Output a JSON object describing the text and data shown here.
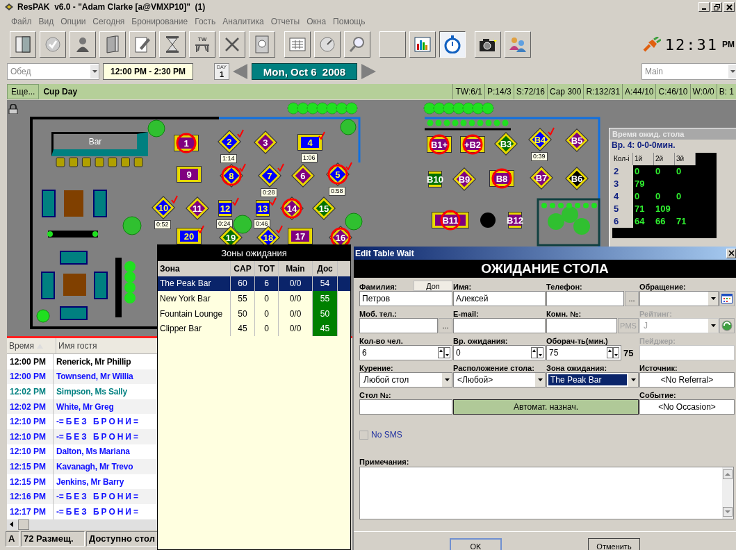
{
  "window": {
    "title": "ResPAK  v6.0 - \"Adam Clarke [a@VMXP10]\"  (1)"
  },
  "menu": [
    "Файл",
    "Вид",
    "Опции",
    "Сегодня",
    "Бронирование",
    "Гость",
    "Аналитика",
    "Отчеты",
    "Окна",
    "Помощь"
  ],
  "toolbar": {
    "tw_badge": "TW",
    "buttons": [
      {
        "selected": false
      },
      {
        "selected": false
      },
      {
        "selected": false
      },
      {
        "selected": false
      },
      {
        "selected": false
      },
      {
        "selected": false
      },
      {
        "selected": false
      },
      {
        "selected": false
      },
      {
        "selected": false
      },
      {
        "selected": false
      },
      {
        "selected": false
      },
      {
        "selected": false
      },
      {
        "selected": false
      },
      {
        "selected": false
      },
      {
        "selected": true
      },
      {
        "selected": false
      },
      {
        "selected": false
      }
    ]
  },
  "clock": {
    "time": "12:31",
    "ampm": "PM"
  },
  "date_bar": {
    "meal": "Обед",
    "time_range": "12:00 PM - 2:30 PM",
    "day_badge": "DAY",
    "day_number": "1",
    "date": "Mon, Oct 6  2008",
    "area": "Main"
  },
  "status_strip": {
    "more_button": "Еще...",
    "event": "Cup Day",
    "stats": [
      "TW:6/1",
      "P:14/3",
      "S:72/16",
      "Cap 300",
      "R:132/31",
      "A:44/10",
      "C:46/10",
      "W:0/0",
      "B: 1"
    ]
  },
  "floor": {
    "bar_label": "Bar",
    "tables": [
      {
        "label": "1",
        "kind": "rect",
        "color": "#800080",
        "checked": false,
        "reserved": true
      },
      {
        "label": "2",
        "kind": "diamond",
        "color": "#0000ff",
        "checked": true,
        "reserved": false,
        "timer": "1:14"
      },
      {
        "label": "3",
        "kind": "diamond",
        "color": "#800080",
        "checked": false,
        "reserved": false
      },
      {
        "label": "4",
        "kind": "rect",
        "color": "#0000ff",
        "checked": true,
        "reserved": false,
        "timer": "1:06"
      },
      {
        "label": "B1+",
        "kind": "rect",
        "color": "#800080",
        "checked": false,
        "reserved": true
      },
      {
        "label": "+B2",
        "kind": "rect",
        "color": "#800080",
        "checked": false,
        "reserved": true
      },
      {
        "label": "B3",
        "kind": "diamond",
        "color": "#007000",
        "checked": false,
        "reserved": false
      },
      {
        "label": "B4",
        "kind": "diamond",
        "color": "#0000ff",
        "checked": true,
        "reserved": false,
        "timer": "0:39"
      },
      {
        "label": "B5",
        "kind": "diamond",
        "color": "#800080",
        "checked": false,
        "reserved": false
      },
      {
        "label": "9",
        "kind": "rect",
        "color": "#800080",
        "checked": false,
        "reserved": false
      },
      {
        "label": "8",
        "kind": "diamond",
        "color": "#0000ff",
        "checked": true,
        "reserved": true
      },
      {
        "label": "7",
        "kind": "diamond",
        "color": "#0000ff",
        "checked": true,
        "reserved": false,
        "timer": "0:28"
      },
      {
        "label": "6",
        "kind": "diamond",
        "color": "#800080",
        "checked": false,
        "reserved": false
      },
      {
        "label": "5",
        "kind": "diamond",
        "color": "#0000ff",
        "checked": true,
        "reserved": true,
        "timer": "0:58"
      },
      {
        "label": "B10",
        "kind": "square",
        "color": "#007000",
        "checked": false,
        "reserved": false
      },
      {
        "label": "B9",
        "kind": "diamond",
        "color": "#800080",
        "checked": false,
        "reserved": false
      },
      {
        "label": "B8",
        "kind": "rect",
        "color": "#800080",
        "checked": false,
        "reserved": true
      },
      {
        "label": "B7",
        "kind": "diamond",
        "color": "#800080",
        "checked": false,
        "reserved": false
      },
      {
        "label": "B6",
        "kind": "diamond",
        "color": "#000000",
        "checked": false,
        "reserved": false
      },
      {
        "label": "10",
        "kind": "diamond",
        "color": "#0000ff",
        "checked": true,
        "reserved": false,
        "timer": "0:52"
      },
      {
        "label": "11",
        "kind": "diamond",
        "color": "#800080",
        "checked": false,
        "reserved": false
      },
      {
        "label": "12",
        "kind": "square",
        "color": "#0000ff",
        "checked": true,
        "reserved": false,
        "timer": "0:24"
      },
      {
        "label": "13",
        "kind": "square",
        "color": "#0000ff",
        "checked": true,
        "reserved": false,
        "timer": "0:46"
      },
      {
        "label": "14",
        "kind": "diamond",
        "color": "#800080",
        "checked": false,
        "reserved": true
      },
      {
        "label": "15",
        "kind": "diamond",
        "color": "#007000",
        "checked": false,
        "reserved": false
      },
      {
        "label": "B11",
        "kind": "wide",
        "color": "#800080",
        "checked": false,
        "reserved": true
      },
      {
        "label": "B12",
        "kind": "square",
        "color": "#800080",
        "checked": false,
        "reserved": false
      },
      {
        "label": "20",
        "kind": "rect",
        "color": "#0000ff",
        "checked": true,
        "reserved": false
      },
      {
        "label": "19",
        "kind": "diamond",
        "color": "#007000",
        "checked": false,
        "reserved": false
      },
      {
        "label": "18",
        "kind": "diamond",
        "color": "#0000ff",
        "checked": true,
        "reserved": false
      },
      {
        "label": "17",
        "kind": "rect",
        "color": "#800080",
        "checked": false,
        "reserved": false
      },
      {
        "label": "16",
        "kind": "diamond",
        "color": "#800080",
        "checked": false,
        "reserved": true
      }
    ]
  },
  "wait_panel": {
    "title": "Время ожид. стола",
    "summary": "Вр. 4: 0-0-0мин.",
    "columns": [
      "Кол-і",
      "1й",
      "2й",
      "3й"
    ],
    "rows": [
      {
        "size": "2",
        "values": [
          "0",
          "0",
          "0"
        ]
      },
      {
        "size": "3",
        "values": [
          "79"
        ]
      },
      {
        "size": "4",
        "values": [
          "0",
          "0",
          "0"
        ]
      },
      {
        "size": "5",
        "values": [
          "71",
          "109"
        ]
      },
      {
        "size": "6",
        "values": [
          "64",
          "66",
          "71"
        ]
      }
    ]
  },
  "guest_list": {
    "columns": [
      "Время",
      "Имя гостя"
    ],
    "rows": [
      {
        "time": "12:00 PM",
        "name": "Renerick, Mr Phillip",
        "color": "#000000"
      },
      {
        "time": "12:00 PM",
        "name": "Townsend, Mr Willia",
        "color": "#1010ff"
      },
      {
        "time": "12:02 PM",
        "name": "Simpson, Ms Sally",
        "color": "#008080"
      },
      {
        "time": "12:02 PM",
        "name": "White, Mr Greg",
        "color": "#1010ff"
      },
      {
        "time": "12:10 PM",
        "name": "-= Б Е З   Б Р О Н И =",
        "color": "#1010ff"
      },
      {
        "time": "12:10 PM",
        "name": "-= Б Е З   Б Р О Н И =",
        "color": "#1010ff"
      },
      {
        "time": "12:10 PM",
        "name": "Dalton, Ms Mariana",
        "color": "#1010ff"
      },
      {
        "time": "12:15 PM",
        "name": "Kavanagh, Mr Trevo",
        "color": "#1010ff"
      },
      {
        "time": "12:15 PM",
        "name": "Jenkins, Mr Barry",
        "color": "#1010ff"
      },
      {
        "time": "12:16 PM",
        "name": "-= Б Е З   Б Р О Н И =",
        "color": "#1010ff"
      },
      {
        "time": "12:17 PM",
        "name": "-= Б Е З   Б Р О Н И =",
        "color": "#1010ff"
      }
    ]
  },
  "status_bar": [
    "A",
    "72 Размещ.",
    "Доступно стол"
  ],
  "zones_popup": {
    "title": "Зоны ожидания",
    "columns": [
      "Зона",
      "CAP",
      "TOT",
      "Main",
      "Дос"
    ],
    "rows": [
      {
        "zone": "The Peak Bar",
        "cap": "60",
        "tot": "6",
        "main": "0/0",
        "available": "54",
        "selected": true
      },
      {
        "zone": "New York Bar",
        "cap": "55",
        "tot": "0",
        "main": "0/0",
        "available": "55",
        "selected": false
      },
      {
        "zone": "Fountain Lounge",
        "cap": "50",
        "tot": "0",
        "main": "0/0",
        "available": "50",
        "selected": false
      },
      {
        "zone": "Clipper Bar",
        "cap": "45",
        "tot": "0",
        "main": "0/0",
        "available": "45",
        "selected": false
      }
    ]
  },
  "dialog": {
    "title": "Edit Table Wait",
    "header": "ОЖИДАНИЕ СТОЛА",
    "fields": [
      {
        "kind": "text",
        "label": "Фамилия:",
        "side_button": "Доп",
        "value": "Петров",
        "disabled": false
      },
      {
        "kind": "text",
        "label": "Имя:",
        "value": "Алексей",
        "disabled": false
      },
      {
        "kind": "text-button",
        "label": "Телефон:",
        "button": "...",
        "button_disabled": false,
        "disabled": false
      },
      {
        "kind": "combo-button",
        "label": "Обращение:",
        "focused": false,
        "disabled": false
      },
      {
        "kind": "text-button",
        "label": "Моб. тел.:",
        "button": "...",
        "button_disabled": false,
        "disabled": false
      },
      {
        "kind": "text",
        "label": "E-mail:",
        "disabled": false
      },
      {
        "kind": "text-button",
        "label": "Комн. №:",
        "button": "PMS",
        "button_disabled": true,
        "disabled": false
      },
      {
        "kind": "combo-button",
        "label": "Рейтинг:",
        "value": "J",
        "focused": false,
        "disabled": true
      },
      {
        "kind": "spin",
        "label": "Кол-во чел.",
        "value": "6",
        "disabled": false
      },
      {
        "kind": "spin",
        "label": "Вр. ожидания:",
        "value": "0",
        "disabled": false
      },
      {
        "kind": "spin",
        "label": "Оборач-ть(мин.)",
        "value": "75",
        "suffix": "75",
        "disabled": false
      },
      {
        "kind": "text",
        "label": "Пейджер:",
        "disabled": true
      },
      {
        "kind": "combo",
        "label": "Курение:",
        "value": "Любой стол",
        "focused": false,
        "disabled": false
      },
      {
        "kind": "combo",
        "label": "Расположение стола:",
        "value": "<Любой>",
        "focused": false,
        "disabled": false
      },
      {
        "kind": "combo",
        "label": "Зона ожидания:",
        "value": "The Peak Bar",
        "focused": true,
        "disabled": false
      },
      {
        "kind": "select-button",
        "label": "Источник:",
        "value": "<No Referral>",
        "disabled": false
      },
      {
        "kind": "text",
        "label": "Стол №:",
        "disabled": false
      },
      {
        "kind": "action",
        "value": "Автомат. назнач.",
        "disabled": false
      },
      {
        "kind": "select-button",
        "label": "Событие:",
        "value": "<No Occasion>",
        "disabled": false
      }
    ],
    "no_sms": {
      "label": "No SMS",
      "checked": false
    },
    "notes_label": "Примечания:",
    "buttons": [
      "OK",
      "Отменить"
    ]
  }
}
